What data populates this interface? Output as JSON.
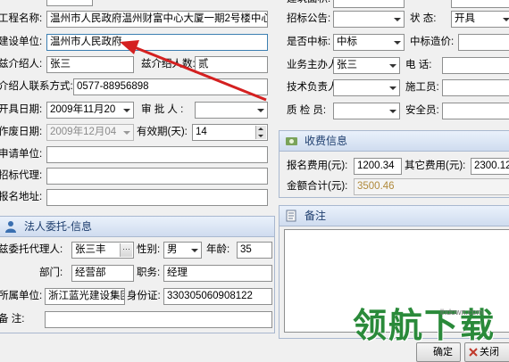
{
  "left_form": {
    "project_name_label": "工程名称:",
    "project_name_value": "温州市人民政府温州财富中心大厦一期2号楼中心大",
    "build_unit_label": "建设单位:",
    "build_unit_value": "温州市人民政府",
    "introducer_label": "兹介绍人:",
    "introducer_value": "张三",
    "introducer_count_label": "兹介绍人数:",
    "introducer_count_value": "贰",
    "contact_label": "介绍人联系方式:",
    "contact_value": "0577-88956898",
    "open_date_label": "开具日期:",
    "open_date_value": "2009年11月20",
    "approver_label": "审 批 人 :",
    "approver_value": "",
    "void_date_label": "作废日期:",
    "void_date_value": "2009年12月04",
    "valid_days_label": "有效期(天):",
    "valid_days_value": "14",
    "apply_unit_label": "申请单位:",
    "tender_agent_label": "招标代理:",
    "register_addr_label": "报名地址:"
  },
  "legal_panel": {
    "title": "法人委托-信息",
    "delegate_label": "兹委托代理人:",
    "delegate_value": "张三丰",
    "delegate_button": "···",
    "gender_label": "性别:",
    "gender_value": "男",
    "age_label": "年龄:",
    "age_value": "35",
    "dept_label": "部门:",
    "dept_value": "经营部",
    "position_label": "职务:",
    "position_value": "经理",
    "unit_label": "所属单位:",
    "unit_value": "浙江蓝光建设集团",
    "idcard_label": "身份证:",
    "idcard_value": "330305060908122",
    "remark_label": "备    注:"
  },
  "right_form": {
    "top_label": "建筑面积:",
    "tender_notice_label": "招标公告:",
    "status_label": "状    态:",
    "status_value": "开具",
    "won_label": "是否中标:",
    "won_value": "中标",
    "won_price_label": "中标造价:",
    "manager_label": "业务主办人:",
    "manager_value": "张三",
    "phone_label": "电    话:",
    "tech_label": "技术负责人:",
    "worker_label": "施工员:",
    "inspector_label": "质    检    员:",
    "safety_label": "安全员:"
  },
  "fee_panel": {
    "title": "收费信息",
    "signup_fee_label": "报名费用(元):",
    "signup_fee_value": "1200.34",
    "other_fee_label": "其它费用(元):",
    "other_fee_value": "2300.12",
    "total_label": "金额合计(元):",
    "total_value": "3500.46"
  },
  "remark_panel": {
    "title": "备注"
  },
  "buttons": {
    "ok": "确定",
    "close": "关闭"
  },
  "watermark": {
    "main": "领航下载",
    "url": "lhdown.com"
  },
  "colors": {
    "annotation_arrow": "#d42020",
    "panel_header": "#cfdcef",
    "field_border_focus": "#3c7fb1"
  }
}
